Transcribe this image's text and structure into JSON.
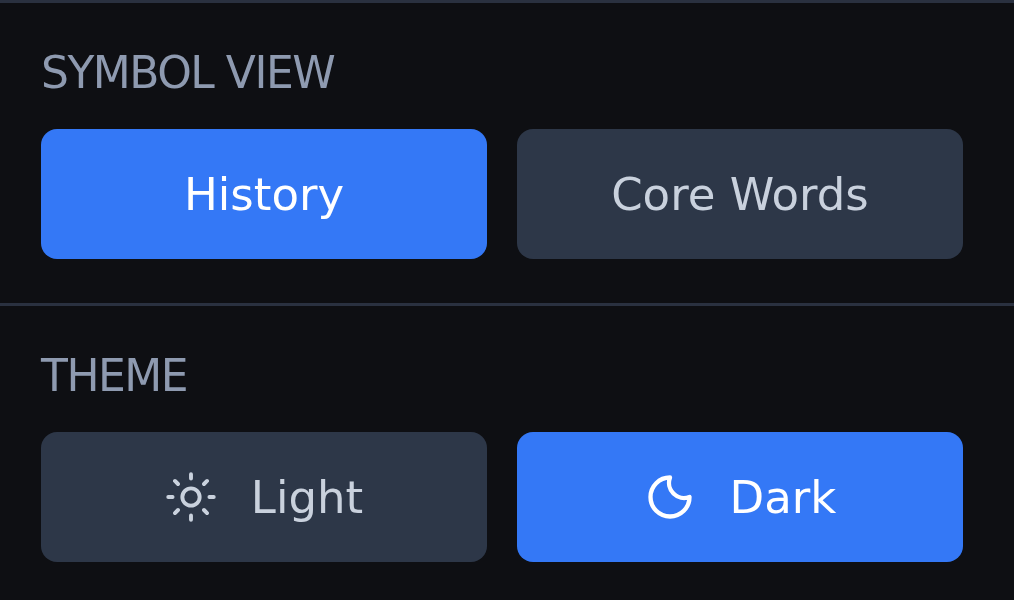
{
  "sections": [
    {
      "heading": "SYMBOL VIEW",
      "options": [
        {
          "label": "History",
          "kind": "plain",
          "selected": true
        },
        {
          "label": "Core Words",
          "kind": "plain",
          "selected": false
        }
      ]
    },
    {
      "heading": "THEME",
      "options": [
        {
          "label": "Light",
          "kind": "sun",
          "selected": false
        },
        {
          "label": "Dark",
          "kind": "moon",
          "selected": true
        }
      ]
    }
  ]
}
